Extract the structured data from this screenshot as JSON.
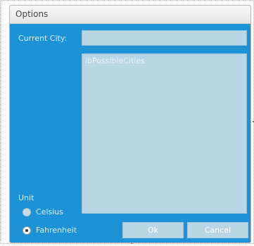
{
  "window": {
    "title": "Options"
  },
  "form": {
    "current_city_label": "Current City:",
    "current_city_value": "",
    "list_placeholder": "lbPossibleCities",
    "unit_label": "Unit",
    "units": [
      {
        "label": "Celsius",
        "selected": false
      },
      {
        "label": "Fahrenheit",
        "selected": true
      }
    ]
  },
  "buttons": {
    "ok": "Ok",
    "cancel": "Cancel"
  }
}
